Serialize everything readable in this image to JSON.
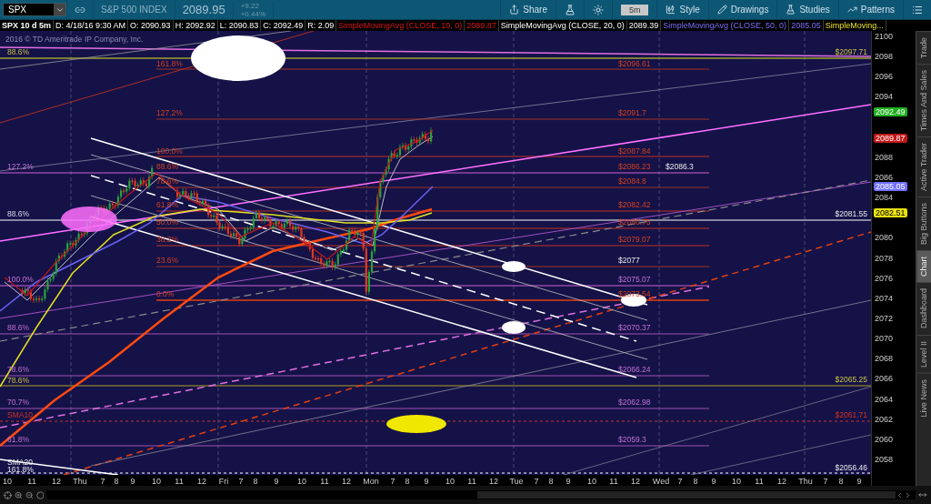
{
  "toolbar": {
    "symbol": "SPX",
    "description": "S&P 500 INDEX",
    "last": "2089.95",
    "change": "+9.22",
    "change_pct": "+0.44%",
    "interval": "5m",
    "buttons": [
      "Share",
      "Style",
      "Drawings",
      "Studies",
      "Patterns"
    ]
  },
  "info_bar": {
    "quote": [
      "SPX 10 d 5m",
      "D: 4/18/16 9:30 AM",
      "O: 2090.93",
      "H: 2092.92",
      "L: 2090.83",
      "C: 2092.49",
      "R: 2.09"
    ],
    "studies": [
      {
        "name": "SimpleMovingAvg (CLOSE, 10, 0)",
        "value": "2089.87"
      },
      {
        "name": "SimpleMovingAvg (CLOSE, 20, 0)",
        "value": "2089.39"
      },
      {
        "name": "SimpleMovingAvg (CLOSE, 50, 0)",
        "value": "2085.05"
      },
      {
        "name": "SimpleMoving..."
      }
    ]
  },
  "chart": {
    "copyright": "2016 © TD Ameritrade IP Company, Inc.",
    "left_labels": [
      "88.6%",
      "127.2%",
      "88.6%",
      "100.0%",
      "88.6%",
      "78.6%",
      "78.6%",
      "70.7%",
      "SMA10",
      "61.8%",
      "SMA20",
      "161.8%"
    ],
    "fib_labels": [
      "161.8%",
      "127.2%",
      "100.0%",
      "88.6%",
      "78.6%",
      "61.8%",
      "50.0%",
      "38.2%",
      "23.6%",
      "0.0%"
    ],
    "level_prices": [
      "$2096.61",
      "$2091.7",
      "$2087.84",
      "$2086.23",
      "$2086.3",
      "$2084.8",
      "$2082.42",
      "$2080.75",
      "$2079.07",
      "$2077",
      "$2075.07",
      "$2073.54",
      "$2070.37",
      "$2066.24",
      "$2062.98",
      "$2059.3"
    ],
    "edge_prices": [
      "$2097.71",
      "$2081.55",
      "$2065.25",
      "$2061.71",
      "$2056.46"
    ],
    "y_ticks": [
      "2100",
      "2098",
      "2096",
      "2094",
      "2088",
      "2086",
      "2084",
      "2080",
      "2078",
      "2076",
      "2074",
      "2072",
      "2070",
      "2068",
      "2066",
      "2064",
      "2062",
      "2060",
      "2058"
    ],
    "price_badges": [
      {
        "text": "2092.49",
        "color": "#1fb01f"
      },
      {
        "text": "2089.87",
        "color": "#c01818"
      },
      {
        "text": "2085.05",
        "color": "#7070ff"
      },
      {
        "text": "2082.51",
        "color": "#e8e010"
      }
    ],
    "x_labels": [
      "10",
      "11",
      "12",
      "Thu",
      "7",
      "8",
      "9",
      "10",
      "11",
      "12",
      "Fri",
      "7",
      "8",
      "9",
      "10",
      "11",
      "12",
      "Mon",
      "7",
      "8",
      "9",
      "10",
      "11",
      "12",
      "Tue",
      "7",
      "8",
      "9",
      "10",
      "11",
      "12",
      "Wed",
      "7",
      "8",
      "9",
      "10",
      "11",
      "12",
      "Thu",
      "7",
      "8",
      "9"
    ]
  },
  "sidebar": {
    "tabs": [
      {
        "label": "Trade",
        "selected": false
      },
      {
        "label": "Times And Sales",
        "selected": false
      },
      {
        "label": "Active Trader",
        "selected": false
      },
      {
        "label": "Big Buttons",
        "selected": false
      },
      {
        "label": "Chart",
        "selected": true
      },
      {
        "label": "Dashboard",
        "selected": false
      },
      {
        "label": "Level II",
        "selected": false
      },
      {
        "label": "Live News",
        "selected": false
      }
    ]
  }
}
